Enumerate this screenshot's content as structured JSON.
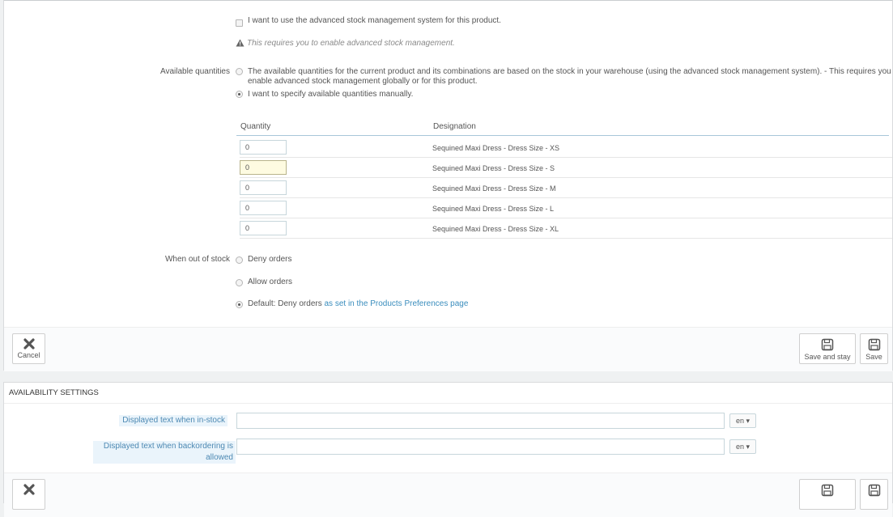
{
  "stock_settings": {
    "advanced_stock_checkbox_label": "I want to use the advanced stock management system for this product.",
    "advanced_stock_warning": "This requires you to enable advanced stock management.",
    "available_quantities_label": "Available quantities",
    "option_warehouse_line1": "The available quantities for the current product and its combinations are based on the stock in your warehouse (using the advanced stock management system).  - This requires you to",
    "option_warehouse_line2": "enable advanced stock management globally or for this product.",
    "option_manual": "I want to specify available quantities manually.",
    "table": {
      "header_quantity": "Quantity",
      "header_designation": "Designation",
      "rows": [
        {
          "quantity": "0",
          "designation": "Sequined Maxi Dress - Dress Size - XS"
        },
        {
          "quantity": "0",
          "designation": "Sequined Maxi Dress - Dress Size - S"
        },
        {
          "quantity": "0",
          "designation": "Sequined Maxi Dress - Dress Size - M"
        },
        {
          "quantity": "0",
          "designation": "Sequined Maxi Dress - Dress Size - L"
        },
        {
          "quantity": "0",
          "designation": "Sequined Maxi Dress - Dress Size - XL"
        }
      ]
    },
    "out_of_stock_label": "When out of stock",
    "oos_deny": "Deny orders",
    "oos_allow": "Allow orders",
    "oos_default": "Default: Deny orders",
    "oos_default_link": "as set in the Products Preferences page"
  },
  "footer": {
    "cancel_label": "Cancel",
    "save_and_stay_label": "Save and stay",
    "save_label": "Save"
  },
  "availability": {
    "heading": "AVAILABILITY SETTINGS",
    "instock_label": "Displayed text when in-stock",
    "backorder_label_line1": "Displayed text when backordering is",
    "backorder_label_line2": "allowed",
    "instock_value": "",
    "backorder_value": "",
    "lang": "en"
  }
}
